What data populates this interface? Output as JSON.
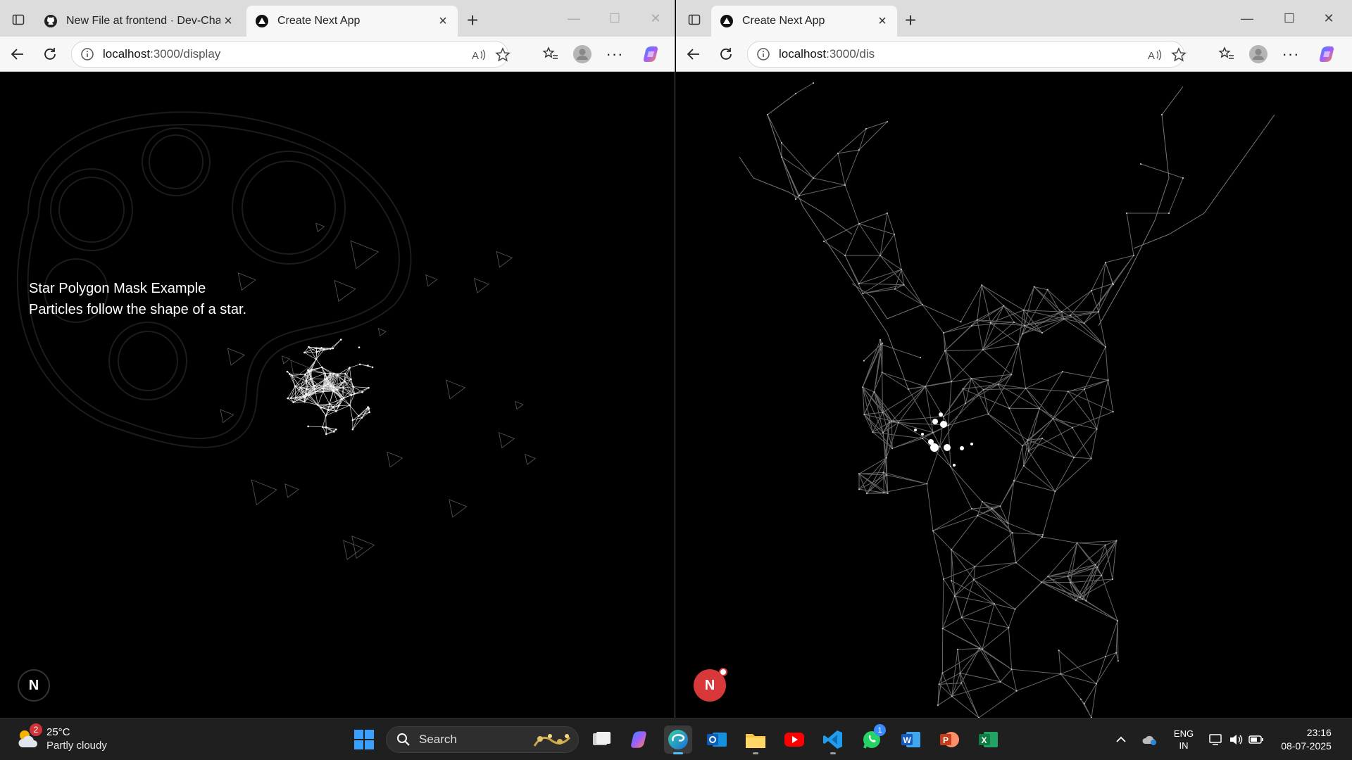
{
  "left_window": {
    "tabs": [
      {
        "title": "New File at frontend · Dev-Chaudhary",
        "active": false,
        "favicon": "github-icon"
      },
      {
        "title": "Create Next App",
        "active": true,
        "favicon": "nextjs-icon"
      }
    ],
    "url_host": "localhost",
    "url_rest": ":3000/display",
    "caption_line1": "Star Polygon Mask Example",
    "caption_line2": "Particles follow the shape of a star.",
    "badge_letter": "N"
  },
  "right_window": {
    "tabs": [
      {
        "title": "Create Next App",
        "active": true,
        "favicon": "nextjs-icon"
      }
    ],
    "url_host": "localhost",
    "url_rest": ":3000/dis",
    "badge_letter": "N"
  },
  "taskbar": {
    "weather_badge": "2",
    "temperature": "25°C",
    "condition": "Partly cloudy",
    "search_placeholder": "Search",
    "whatsapp_badge": "1",
    "language_top": "ENG",
    "language_bottom": "IN",
    "time": "23:16",
    "date": "08-07-2025"
  },
  "colors": {
    "tabstrip": "#dcdcdc",
    "toolbar": "#f7f7f7",
    "taskbar": "#1f1f1f",
    "next_badge_red": "#d9383a",
    "accent": "#4cc2ff"
  }
}
